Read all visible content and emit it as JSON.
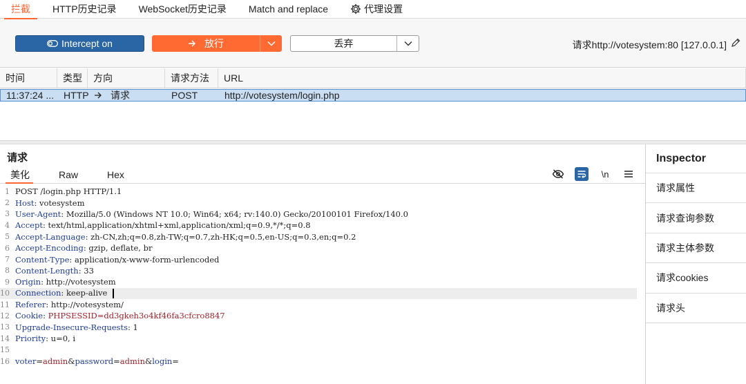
{
  "tabs": {
    "intercept": "拦截",
    "http_history": "HTTP历史记录",
    "websocket_history": "WebSocket历史记录",
    "match_replace": "Match and replace",
    "proxy_settings": "代理设置"
  },
  "toolbar": {
    "intercept_label": "Intercept on",
    "forward_label": "放行",
    "drop_label": "丢弃",
    "request_target": "请求http://votesystem:80  [127.0.0.1]"
  },
  "history": {
    "columns": [
      "时间",
      "类型",
      "方向",
      "请求方法",
      "URL"
    ],
    "row": {
      "time": "11:37:24 ...",
      "type": "HTTP",
      "direction": "请求",
      "method": "POST",
      "url": "http://votesystem/login.php"
    }
  },
  "request_panel": {
    "title": "请求",
    "tabs": [
      "美化",
      "Raw",
      "Hex"
    ],
    "newline_toggle": "\\n"
  },
  "request_lines": [
    {
      "n": "1",
      "k": "",
      "v": "POST /login.php HTTP/1.1"
    },
    {
      "n": "2",
      "k": "Host",
      "v": "votesystem"
    },
    {
      "n": "3",
      "k": "User-Agent",
      "v": "Mozilla/5.0 (Windows NT 10.0; Win64; x64; rv:140.0) Gecko/20100101 Firefox/140.0"
    },
    {
      "n": "4",
      "k": "Accept",
      "v": "text/html,application/xhtml+xml,application/xml;q=0.9,*/*;q=0.8"
    },
    {
      "n": "5",
      "k": "Accept-Language",
      "v": "zh-CN,zh;q=0.8,zh-TW;q=0.7,zh-HK;q=0.5,en-US;q=0.3,en;q=0.2"
    },
    {
      "n": "6",
      "k": "Accept-Encoding",
      "v": "gzip, deflate, br"
    },
    {
      "n": "7",
      "k": "Content-Type",
      "v": "application/x-www-form-urlencoded"
    },
    {
      "n": "8",
      "k": "Content-Length",
      "v": "33"
    },
    {
      "n": "9",
      "k": "Origin",
      "v": "http://votesystem"
    },
    {
      "n": "10",
      "k": "Connection",
      "v": "keep-alive"
    },
    {
      "n": "11",
      "k": "Referer",
      "v": "http://votesystem/"
    },
    {
      "n": "12",
      "k": "Cookie",
      "v": "PHPSESSID=dd3gkeh3o4kf46fa3cfcro8847"
    },
    {
      "n": "13",
      "k": "Upgrade-Insecure-Requests",
      "v": "1"
    },
    {
      "n": "14",
      "k": "Priority",
      "v": "u=0, i"
    },
    {
      "n": "15",
      "k": "",
      "v": ""
    },
    {
      "n": "16",
      "k": "",
      "v": "voter=admin&password=admin&login="
    }
  ],
  "inspector": {
    "title": "Inspector",
    "items": [
      "请求属性",
      "请求查询参数",
      "请求主体参数",
      "请求cookies",
      "请求头"
    ]
  },
  "colors": {
    "accent": "#ff6633",
    "intercept_button": "#2a65a5",
    "header_key": "#1f3b9a",
    "cookie_value": "#a3202a",
    "selected_row": "#c9ddf3"
  }
}
